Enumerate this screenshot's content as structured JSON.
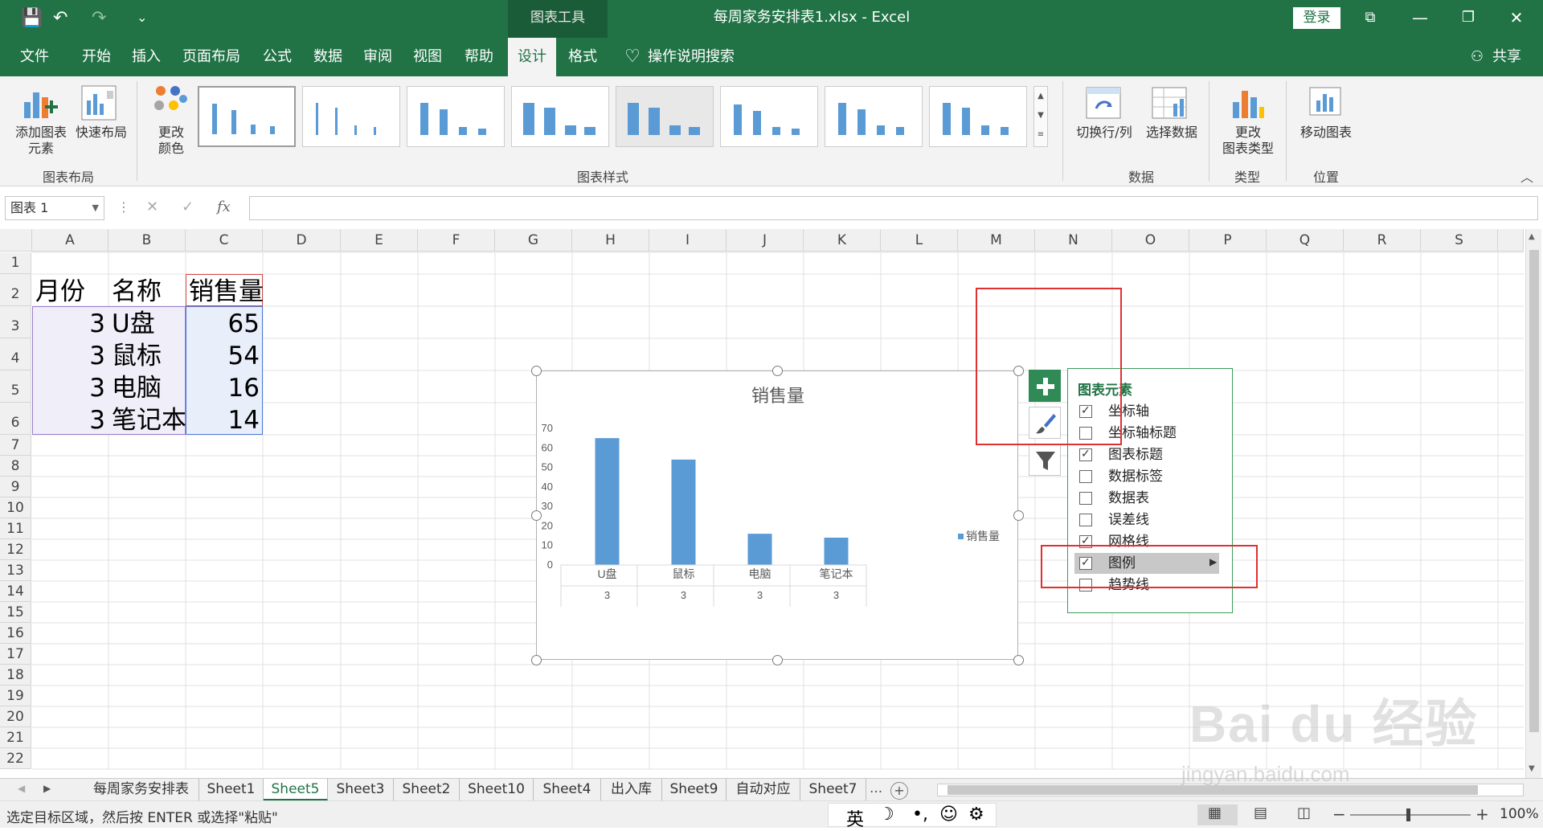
{
  "titlebar": {
    "context_tab": "图表工具",
    "doc_title": "每周家务安排表1.xlsx  -  Excel",
    "login": "登录",
    "qat_save": "💾",
    "qat_undo": "↶",
    "qat_redo": "↷",
    "qat_more": "⌄"
  },
  "tabs": [
    {
      "label": "文件"
    },
    {
      "label": "开始"
    },
    {
      "label": "插入"
    },
    {
      "label": "页面布局"
    },
    {
      "label": "公式"
    },
    {
      "label": "数据"
    },
    {
      "label": "审阅"
    },
    {
      "label": "视图"
    },
    {
      "label": "帮助"
    },
    {
      "label": "设计"
    },
    {
      "label": "格式"
    }
  ],
  "search_label": "操作说明搜索",
  "share_label": "共享",
  "ribbon": {
    "add_element_line1": "添加图表",
    "add_element_line2": "元素",
    "quick_layout": "快速布局",
    "change_color_line1": "更改",
    "change_color_line2": "颜色",
    "group_layout": "图表布局",
    "group_styles": "图表样式",
    "switch_rowcol": "切换行/列",
    "select_data": "选择数据",
    "group_data": "数据",
    "change_type_line1": "更改",
    "change_type_line2": "图表类型",
    "group_type": "类型",
    "move_chart": "移动图表",
    "group_location": "位置"
  },
  "formulabar": {
    "namebox": "图表 1",
    "cancel": "✕",
    "enter": "✓",
    "fx": "fx"
  },
  "columns": [
    "A",
    "B",
    "C",
    "D",
    "E",
    "F",
    "G",
    "H",
    "I",
    "J",
    "K",
    "L",
    "M",
    "N",
    "O",
    "P",
    "Q",
    "R",
    "S"
  ],
  "rows": [
    "1",
    "2",
    "3",
    "4",
    "5",
    "6",
    "7",
    "8",
    "9",
    "10",
    "11",
    "12",
    "13",
    "14",
    "15",
    "16",
    "17",
    "18",
    "19",
    "20",
    "21",
    "22"
  ],
  "table": {
    "headers": [
      "月份",
      "名称",
      "销售量"
    ],
    "rows": [
      {
        "month": "3",
        "name": "U盘",
        "qty": "65"
      },
      {
        "month": "3",
        "name": "鼠标",
        "qty": "54"
      },
      {
        "month": "3",
        "name": "电脑",
        "qty": "16"
      },
      {
        "month": "3",
        "name": "笔记本",
        "qty": "14"
      }
    ]
  },
  "chart_data": {
    "type": "bar",
    "title": "销售量",
    "categories": [
      "U盘",
      "鼠标",
      "电脑",
      "笔记本"
    ],
    "subcategories": [
      "3",
      "3",
      "3",
      "3"
    ],
    "series": [
      {
        "name": "销售量",
        "values": [
          65,
          54,
          16,
          14
        ],
        "color": "#5b9bd5"
      }
    ],
    "yticks": [
      "0",
      "10",
      "20",
      "30",
      "40",
      "50",
      "60",
      "70"
    ],
    "ylim": [
      0,
      70
    ],
    "legend": "right",
    "grid": false
  },
  "flyout": {
    "title": "图表元素",
    "items": [
      {
        "label": "坐标轴",
        "checked": true
      },
      {
        "label": "坐标轴标题",
        "checked": false
      },
      {
        "label": "图表标题",
        "checked": true
      },
      {
        "label": "数据标签",
        "checked": false
      },
      {
        "label": "数据表",
        "checked": false
      },
      {
        "label": "误差线",
        "checked": false
      },
      {
        "label": "网格线",
        "checked": true
      },
      {
        "label": "图例",
        "checked": true
      },
      {
        "label": "趋势线",
        "checked": false
      }
    ]
  },
  "sheets": [
    {
      "label": "每周家务安排表"
    },
    {
      "label": "Sheet1"
    },
    {
      "label": "Sheet5"
    },
    {
      "label": "Sheet3"
    },
    {
      "label": "Sheet2"
    },
    {
      "label": "Sheet10"
    },
    {
      "label": "Sheet4"
    },
    {
      "label": "出入库"
    },
    {
      "label": "Sheet9"
    },
    {
      "label": "自动对应"
    },
    {
      "label": "Sheet7"
    }
  ],
  "sheet_more": "...",
  "status": {
    "message": "选定目标区域，然后按 ENTER 或选择\"粘贴\"",
    "ime": "英",
    "zoom": "100%"
  },
  "watermark": {
    "logo": "Bai du 经验",
    "url": "jingyan.baidu.com"
  },
  "colors": {
    "accent": "#217346",
    "series": "#5b9bd5",
    "highlight": "#e03030"
  }
}
